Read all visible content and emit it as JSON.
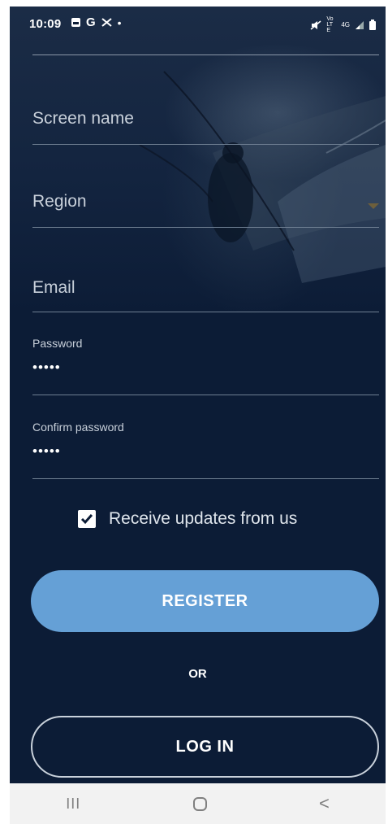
{
  "status_bar": {
    "time": "10:09",
    "left_icons": [
      "gallery-icon",
      "google-icon",
      "missed-call-icon",
      "dot-icon"
    ],
    "right_icons": [
      "mute-icon",
      "volte-icon",
      "4g-icon",
      "signal-icon",
      "battery-icon"
    ],
    "volte_label": "VoLTE",
    "net_label": "4G"
  },
  "form": {
    "screen_name": {
      "label": "Screen name"
    },
    "region": {
      "label": "Region"
    },
    "email": {
      "label": "Email"
    },
    "password": {
      "label": "Password",
      "value": "•••••"
    },
    "confirm_password": {
      "label": "Confirm password",
      "value": "•••••"
    },
    "updates": {
      "label": "Receive updates from us",
      "checked": true
    }
  },
  "actions": {
    "register_label": "REGISTER",
    "or_label": "OR",
    "login_label": "LOG IN"
  },
  "nav_bar": {
    "recents_glyph": "III",
    "back_glyph": "<"
  },
  "colors": {
    "background": "#0c1c36",
    "register_button": "#65a0d6",
    "nav_bar": "#f2f2f2"
  }
}
